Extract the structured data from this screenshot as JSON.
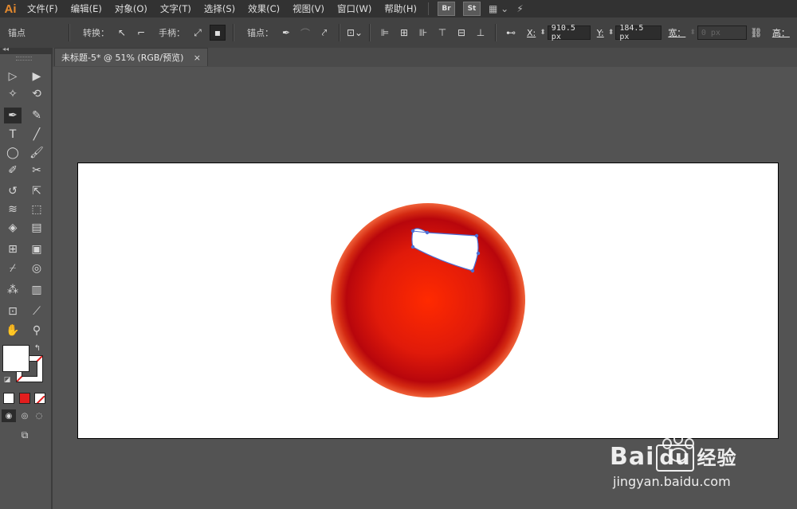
{
  "app": {
    "logo": "Ai"
  },
  "menu": {
    "items": [
      "文件(F)",
      "编辑(E)",
      "对象(O)",
      "文字(T)",
      "选择(S)",
      "效果(C)",
      "视图(V)",
      "窗口(W)",
      "帮助(H)"
    ],
    "bridge_label": "Br",
    "stock_label": "St"
  },
  "control_bar": {
    "anchor_label": "锚点",
    "convert_label": "转换：",
    "handles_label": "手柄：",
    "anchors_label": "锚点：",
    "x_label": "X:",
    "x_value": "910.5 px",
    "y_label": "Y:",
    "y_value": "184.5 px",
    "width_label": "宽：",
    "width_value": "0 px",
    "height_label": "高："
  },
  "document": {
    "tab_title": "未标题-5* @ 51% (RGB/预览)",
    "close_glyph": "×"
  },
  "toolbar": {
    "collapse_glyph": "◂◂"
  },
  "watermark": {
    "brand": "Bai",
    "brand_suffix": "经验",
    "url": "jingyan.baidu.com"
  },
  "colors": {
    "accent": "#e58a2e",
    "fill": "#ffffff",
    "ball_center": "#ff2a00",
    "ball_edge": "#b00000",
    "selection": "#4b6ed6"
  }
}
